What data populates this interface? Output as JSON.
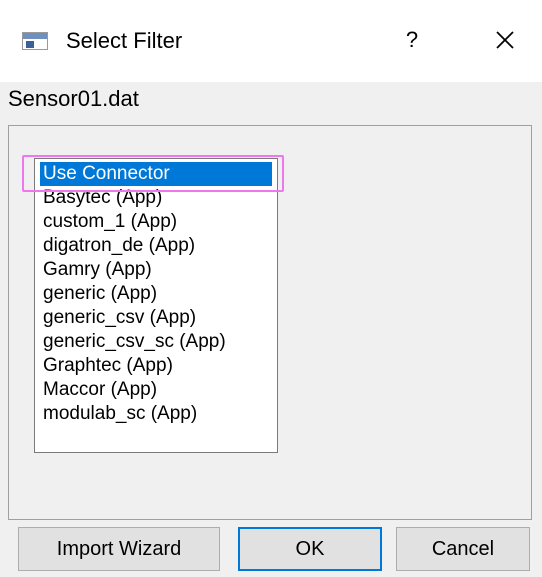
{
  "window": {
    "title": "Select Filter",
    "help_glyph": "?",
    "close_icon": "close-icon"
  },
  "file": {
    "name": "Sensor01.dat"
  },
  "filter_list": {
    "items": [
      {
        "label": "Use Connector",
        "selected": true
      },
      {
        "label": "Basytec (App)",
        "selected": false
      },
      {
        "label": "custom_1 (App)",
        "selected": false
      },
      {
        "label": "digatron_de (App)",
        "selected": false
      },
      {
        "label": "Gamry (App)",
        "selected": false
      },
      {
        "label": "generic (App)",
        "selected": false
      },
      {
        "label": "generic_csv (App)",
        "selected": false
      },
      {
        "label": "generic_csv_sc (App)",
        "selected": false
      },
      {
        "label": "Graphtec (App)",
        "selected": false
      },
      {
        "label": "Maccor (App)",
        "selected": false
      },
      {
        "label": "modulab_sc (App)",
        "selected": false
      }
    ]
  },
  "buttons": {
    "import_wizard": "Import Wizard",
    "ok": "OK",
    "cancel": "Cancel"
  },
  "colors": {
    "selection": "#0078d7",
    "highlight_outline": "#ee77ee",
    "dialog_bg": "#f0f0f0"
  }
}
